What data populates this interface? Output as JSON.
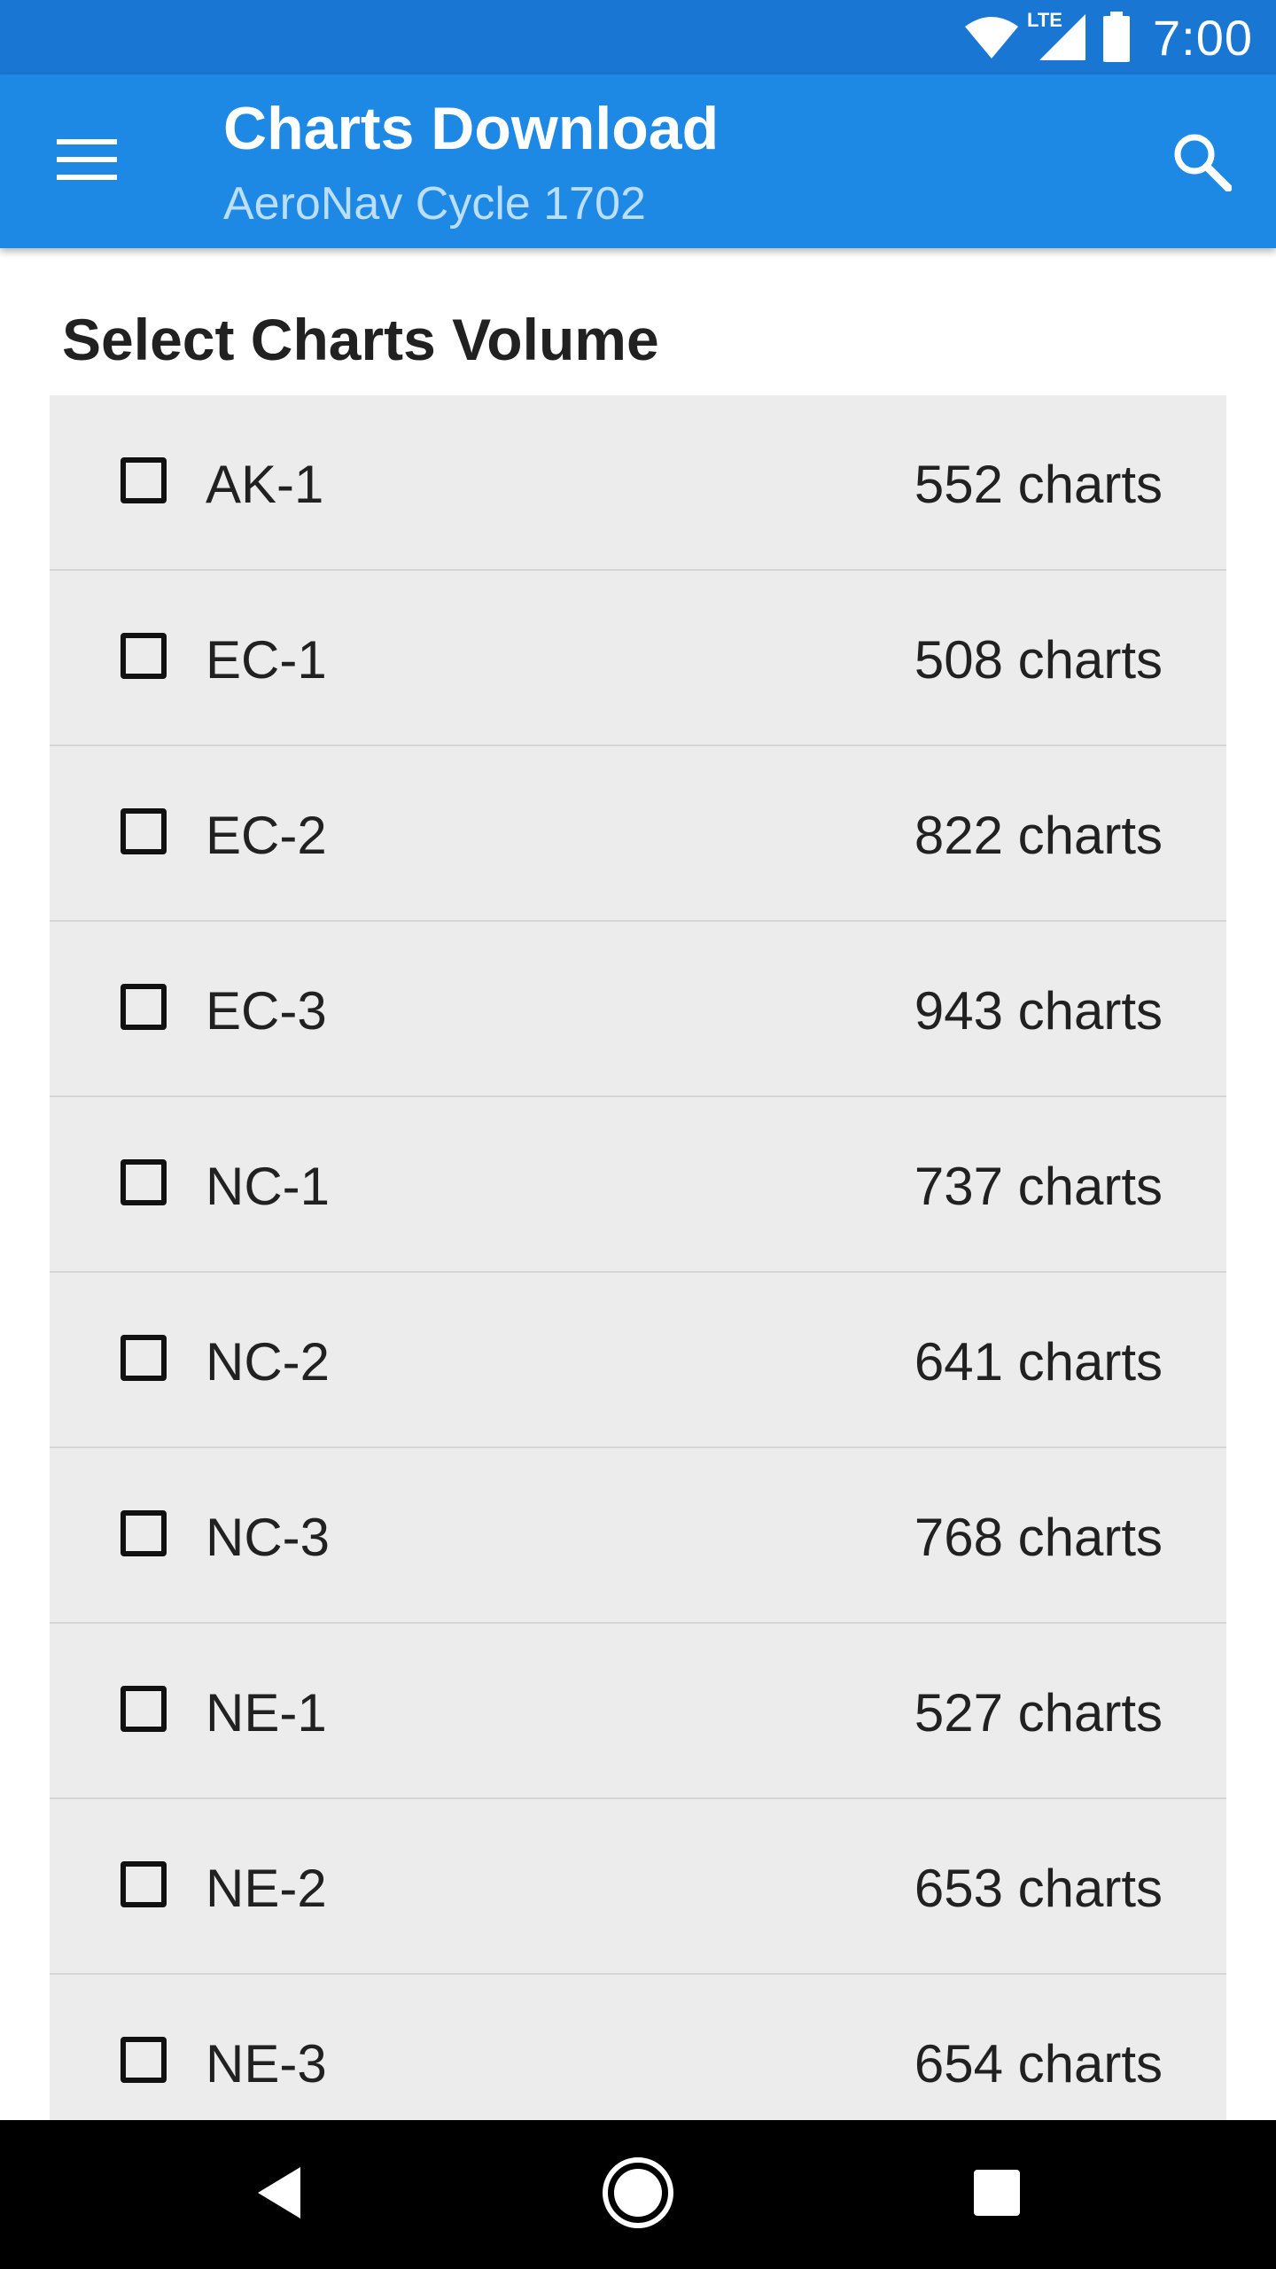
{
  "status_bar": {
    "time": "7:00",
    "network_label": "LTE",
    "icons": [
      "wifi-icon",
      "lte-signal-icon",
      "battery-icon"
    ],
    "color": "#1976d2"
  },
  "app_bar": {
    "title": "Charts Download",
    "subtitle": "AeroNav Cycle 1702",
    "menu_icon": "hamburger-menu-icon",
    "search_icon": "search-icon",
    "color": "#1e88e5",
    "subtitle_color": "#bbdefb"
  },
  "main": {
    "section_title": "Select Charts Volume",
    "list_background": "#ececec",
    "volumes": [
      {
        "name": "AK-1",
        "count": "552 charts",
        "checked": false
      },
      {
        "name": "EC-1",
        "count": "508 charts",
        "checked": false
      },
      {
        "name": "EC-2",
        "count": "822 charts",
        "checked": false
      },
      {
        "name": "EC-3",
        "count": "943 charts",
        "checked": false
      },
      {
        "name": "NC-1",
        "count": "737 charts",
        "checked": false
      },
      {
        "name": "NC-2",
        "count": "641 charts",
        "checked": false
      },
      {
        "name": "NC-3",
        "count": "768 charts",
        "checked": false
      },
      {
        "name": "NE-1",
        "count": "527 charts",
        "checked": false
      },
      {
        "name": "NE-2",
        "count": "653 charts",
        "checked": false
      },
      {
        "name": "NE-3",
        "count": "654 charts",
        "checked": false
      }
    ]
  },
  "nav_bar": {
    "icons": [
      "back-icon",
      "home-icon",
      "recents-icon"
    ]
  }
}
